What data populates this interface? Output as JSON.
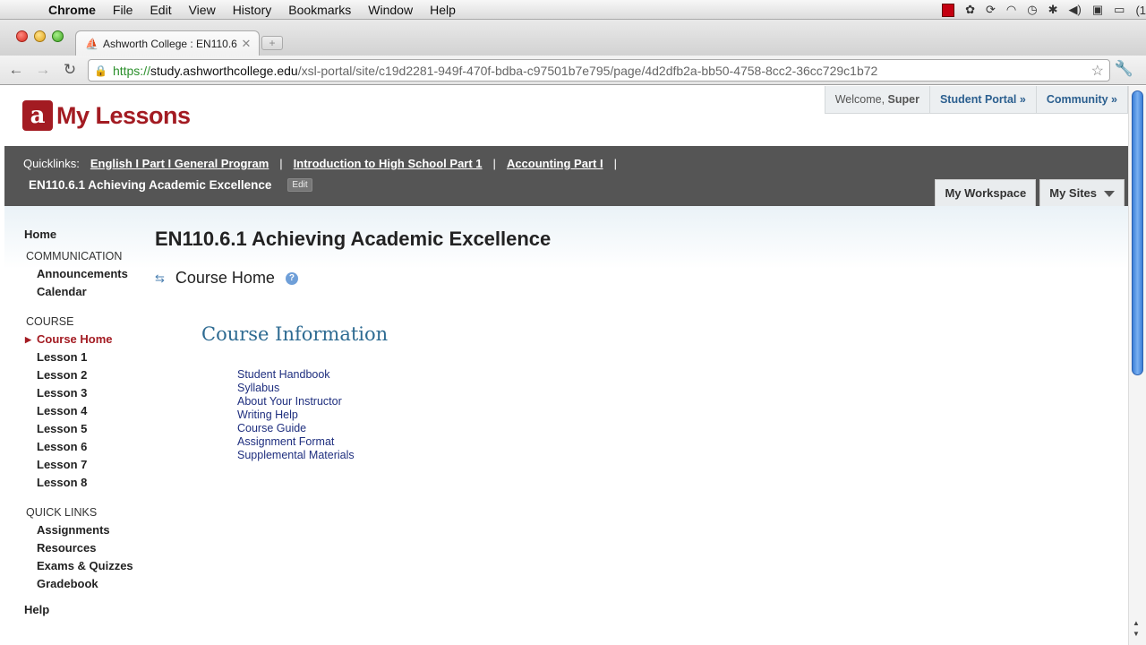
{
  "menubar": {
    "app": "Chrome",
    "menus": [
      "File",
      "Edit",
      "View",
      "History",
      "Bookmarks",
      "Window",
      "Help"
    ],
    "tray_end": "(1"
  },
  "browser": {
    "tab_title": "Ashworth College : EN110.6",
    "url": {
      "scheme": "https://",
      "host": "study.ashworthcollege.edu",
      "path": "/xsl-portal/site/c19d2281-949f-470f-bdba-c97501b7e795/page/4d2dfb2a-bb50-4758-8cc2-36cc729c1b72"
    }
  },
  "header": {
    "logo_text": "My Lessons",
    "welcome": "Welcome,",
    "user": "Super",
    "student_portal": "Student Portal »",
    "community": "Community »"
  },
  "darkbar": {
    "quicklinks_label": "Quicklinks:",
    "quicklinks": [
      "English I Part I General Program",
      "Introduction to High School Part 1",
      "Accounting Part I"
    ],
    "separator": "|",
    "site_title": "EN110.6.1 Achieving Academic Excellence",
    "edit": "Edit",
    "my_workspace": "My Workspace",
    "my_sites": "My Sites"
  },
  "leftnav": {
    "home": "Home",
    "communication": "COMMUNICATION",
    "communication_items": [
      "Announcements",
      "Calendar"
    ],
    "course": "COURSE",
    "course_items": [
      "Course Home",
      "Lesson 1",
      "Lesson 2",
      "Lesson 3",
      "Lesson 4",
      "Lesson 5",
      "Lesson 6",
      "Lesson 7",
      "Lesson 8"
    ],
    "quick_links": "QUICK LINKS",
    "quick_items": [
      "Assignments",
      "Resources",
      "Exams & Quizzes",
      "Gradebook"
    ],
    "help": "Help"
  },
  "main": {
    "page_title": "EN110.6.1 Achieving Academic Excellence",
    "tool_title": "Course Home",
    "section_title": "Course Information",
    "links": [
      "Student Handbook",
      "Syllabus",
      "About Your Instructor",
      "Writing Help",
      "Course Guide",
      "Assignment Format",
      "Supplemental Materials"
    ]
  }
}
